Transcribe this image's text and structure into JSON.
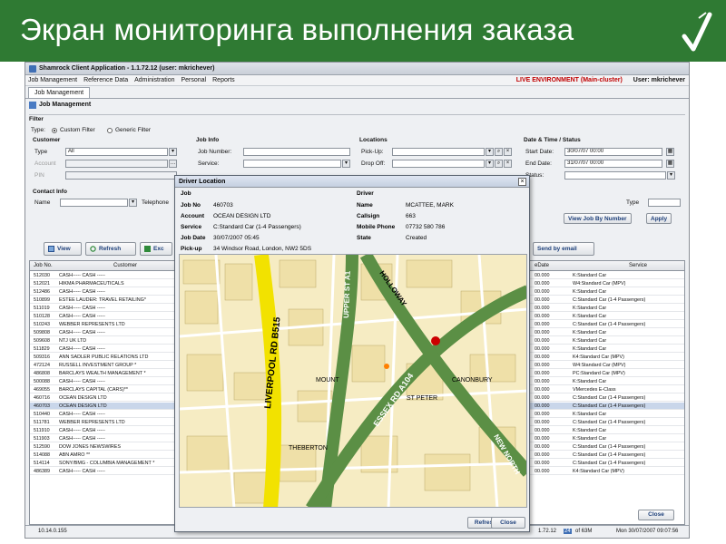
{
  "slide": {
    "title": "Экран мониторинга выполнения заказа"
  },
  "app": {
    "title": "Shamrock Client Application - 1.1.72.12 (user: mkrichever)",
    "menu": [
      "Job Management",
      "Reference Data",
      "Administration",
      "Personal",
      "Reports"
    ],
    "environment": "LIVE ENVIRONMENT (Main-cluster)",
    "user": "User: mkrichever",
    "tab": "Job Management",
    "panel_title": "Job Management",
    "filter": {
      "label": "Filter",
      "type_label": "Type:",
      "custom_filter": "Custom Filter",
      "generic_filter": "Generic Filter",
      "customer_section": "Customer",
      "customer_type_label": "Type",
      "customer_type_value": "All",
      "account_label": "Account",
      "pin_label": "PIN",
      "jobinfo_section": "Job Info",
      "job_number_label": "Job Number:",
      "service_label": "Service:",
      "locations_section": "Locations",
      "pickup_label": "Pick-Up:",
      "dropoff_label": "Drop Off:",
      "datetime_section": "Date & Time / Status",
      "start_date_label": "Start Date:",
      "start_date_value": "30/07/07 00:00",
      "end_date_label": "End Date:",
      "end_date_value": "31/07/07 00:00",
      "status_label": "Status:",
      "contact_section": "Contact Info",
      "name_label": "Name",
      "telephone_label": "Telephone",
      "type_label2": "Type"
    },
    "buttons": {
      "view": "View",
      "refresh": "Refresh",
      "exc": "Exc",
      "send_by_email": "Send by email",
      "view_job_by_number": "View Job By Number",
      "apply": "Apply",
      "close": "Close"
    },
    "grid": {
      "headers": [
        "Job No.",
        "Customer",
        "eDate",
        "Service"
      ],
      "rows": [
        {
          "job": "512030",
          "customer": "CASH----- CASH -----",
          "date": "00.000",
          "service": "K:Standard Car"
        },
        {
          "job": "512021",
          "customer": "HIKMA PHARMACEUTICALS",
          "date": "00.000",
          "service": "W4:Standard Car (MPV)"
        },
        {
          "job": "512486",
          "customer": "CASH----- CASH -----",
          "date": "00.000",
          "service": "K:Standard Car"
        },
        {
          "job": "510899",
          "customer": "ESTEE LAUDER: TRAVEL RETAILING*",
          "date": "00.000",
          "service": "C:Standard Car (1-4 Passengers)"
        },
        {
          "job": "511019",
          "customer": "CASH----- CASH -----",
          "date": "00.000",
          "service": "K:Standard Car"
        },
        {
          "job": "510128",
          "customer": "CASH----- CASH -----",
          "date": "00.000",
          "service": "K:Standard Car"
        },
        {
          "job": "510243",
          "customer": "WEBBER REPRESENTS LTD",
          "date": "00.000",
          "service": "C:Standard Car (1-4 Passengers)"
        },
        {
          "job": "509808",
          "customer": "CASH----- CASH -----",
          "date": "00.000",
          "service": "K:Standard Car"
        },
        {
          "job": "509608",
          "customer": "NTJ UK LTD",
          "date": "00.000",
          "service": "K:Standard Car"
        },
        {
          "job": "511829",
          "customer": "CASH----- CASH -----",
          "date": "00.000",
          "service": "K:Standard Car"
        },
        {
          "job": "509316",
          "customer": "ANN SADLER PUBLIC RELATIONS LTD",
          "date": "00.000",
          "service": "K4:Standard Car (MPV)"
        },
        {
          "job": "472124",
          "customer": "RUSSELL INVESTMENT GROUP *",
          "date": "00.000",
          "service": "W4:Standard Car (MPV)"
        },
        {
          "job": "486808",
          "customer": "BARCLAYS WEALTH MANAGEMENT *",
          "date": "00.000",
          "service": "PC:Standard Car (MPV)"
        },
        {
          "job": "500088",
          "customer": "CASH----- CASH -----",
          "date": "00.000",
          "service": "K:Standard Car"
        },
        {
          "job": "469055",
          "customer": "BARCLAYS CAPITAL (CARS)**",
          "date": "00.000",
          "service": "VMercedes E-Class"
        },
        {
          "job": "460716",
          "customer": "OCEAN DESIGN LTD",
          "date": "00.000",
          "service": "C:Standard Car (1-4 Passengers)"
        },
        {
          "job": "460703",
          "customer": "OCEAN DESIGN LTD",
          "date": "00.000",
          "service": "C:Standard Car (1-4 Passengers)",
          "selected": true
        },
        {
          "job": "510440",
          "customer": "CASH----- CASH -----",
          "date": "00.000",
          "service": "K:Standard Car"
        },
        {
          "job": "511781",
          "customer": "WEBBER REPRESENTS LTD",
          "date": "00.000",
          "service": "C:Standard Car (1-4 Passengers)"
        },
        {
          "job": "511910",
          "customer": "CASH----- CASH -----",
          "date": "00.000",
          "service": "K:Standard Car"
        },
        {
          "job": "511903",
          "customer": "CASH----- CASH -----",
          "date": "00.000",
          "service": "K:Standard Car"
        },
        {
          "job": "512590",
          "customer": "DOW JONES NEWSWIRES",
          "date": "00.000",
          "service": "C:Standard Car (1-4 Passengers)"
        },
        {
          "job": "514088",
          "customer": "ABN AMRO **",
          "date": "00.000",
          "service": "C:Standard Car (1-4 Passengers)"
        },
        {
          "job": "514114",
          "customer": "SONY/BMG - COLUMBIA MANAGEMENT *",
          "date": "00.000",
          "service": "C:Standard Car (1-4 Passengers)"
        },
        {
          "job": "486389",
          "customer": "CASH----- CASH -----",
          "date": "00.000",
          "service": "K4:Standard Car (MPV)"
        }
      ]
    },
    "statusbar": {
      "ip": "10.14.0.155",
      "version": "1.72.12",
      "mem_used": "24",
      "mem_total": "of 63M",
      "datetime": "Mon 30/07/2007 09:07:56"
    }
  },
  "popup": {
    "title": "Driver Location",
    "job_section": "Job",
    "driver_section": "Driver",
    "job_no_label": "Job No",
    "job_no": "460703",
    "account_label": "Account",
    "account": "OCEAN DESIGN LTD",
    "service_label": "Service",
    "service": "C:Standard Car (1-4 Passengers)",
    "job_date_label": "Job Date",
    "job_date": "30/07/2007 05:45",
    "pickup_label": "Pick-up",
    "pickup": "34 Windsor Road, London, NW2 5DS",
    "name_label": "Name",
    "name": "MCATTEE, MARK",
    "callsign_label": "Callsign",
    "callsign": "663",
    "mobile_label": "Mobile Phone",
    "mobile": "07732 580 786",
    "state_label": "State",
    "state": "Created",
    "refresh": "Refresh",
    "close": "Close",
    "map_labels": {
      "road1": "LIVERPOOL RD B515",
      "road2": "ESSEX RD A104",
      "road3": "UPPER ST A1",
      "road4": "NEW NORTH",
      "road5": "HOLLOWAY",
      "st1": "THEBERTON",
      "st2": "MOUNT",
      "st3": "CANONBURY",
      "st4": "ST PETER"
    }
  }
}
